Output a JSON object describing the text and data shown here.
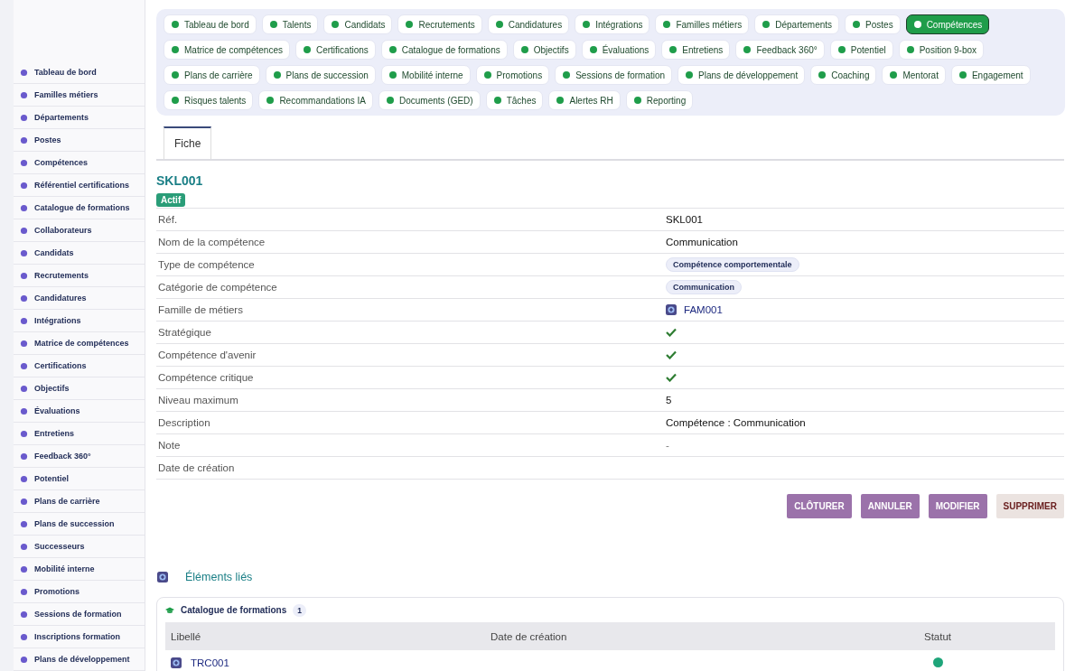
{
  "sidebar": {
    "items": [
      {
        "label": "Tableau de bord"
      },
      {
        "label": "Familles métiers"
      },
      {
        "label": "Départements"
      },
      {
        "label": "Postes"
      },
      {
        "label": "Compétences"
      },
      {
        "label": "Référentiel certifications"
      },
      {
        "label": "Catalogue de formations"
      },
      {
        "label": "Collaborateurs"
      },
      {
        "label": "Candidats"
      },
      {
        "label": "Recrutements"
      },
      {
        "label": "Candidatures"
      },
      {
        "label": "Intégrations"
      },
      {
        "label": "Matrice de compétences"
      },
      {
        "label": "Certifications"
      },
      {
        "label": "Objectifs"
      },
      {
        "label": "Évaluations"
      },
      {
        "label": "Entretiens"
      },
      {
        "label": "Feedback 360°"
      },
      {
        "label": "Potentiel"
      },
      {
        "label": "Plans de carrière"
      },
      {
        "label": "Plans de succession"
      },
      {
        "label": "Successeurs"
      },
      {
        "label": "Mobilité interne"
      },
      {
        "label": "Promotions"
      },
      {
        "label": "Sessions de formation"
      },
      {
        "label": "Inscriptions formation"
      },
      {
        "label": "Plans de développement"
      }
    ]
  },
  "modules": [
    {
      "label": "Tableau de bord",
      "selected": false
    },
    {
      "label": "Talents",
      "selected": false
    },
    {
      "label": "Candidats",
      "selected": false
    },
    {
      "label": "Recrutements",
      "selected": false
    },
    {
      "label": "Candidatures",
      "selected": false
    },
    {
      "label": "Intégrations",
      "selected": false
    },
    {
      "label": "Familles métiers",
      "selected": false
    },
    {
      "label": "Départements",
      "selected": false
    },
    {
      "label": "Postes",
      "selected": false
    },
    {
      "label": "Compétences",
      "selected": true
    },
    {
      "label": "Matrice de compétences",
      "selected": false
    },
    {
      "label": "Certifications",
      "selected": false
    },
    {
      "label": "Catalogue de formations",
      "selected": false
    },
    {
      "label": "Objectifs",
      "selected": false
    },
    {
      "label": "Évaluations",
      "selected": false
    },
    {
      "label": "Entretiens",
      "selected": false
    },
    {
      "label": "Feedback 360°",
      "selected": false
    },
    {
      "label": "Potentiel",
      "selected": false
    },
    {
      "label": "Position 9-box",
      "selected": false
    },
    {
      "label": "Plans de carrière",
      "selected": false
    },
    {
      "label": "Plans de succession",
      "selected": false
    },
    {
      "label": "Mobilité interne",
      "selected": false
    },
    {
      "label": "Promotions",
      "selected": false
    },
    {
      "label": "Sessions de formation",
      "selected": false
    },
    {
      "label": "Plans de développement",
      "selected": false
    },
    {
      "label": "Coaching",
      "selected": false
    },
    {
      "label": "Mentorat",
      "selected": false
    },
    {
      "label": "Engagement",
      "selected": false
    },
    {
      "label": "Risques talents",
      "selected": false
    },
    {
      "label": "Recommandations IA",
      "selected": false
    },
    {
      "label": "Documents (GED)",
      "selected": false
    },
    {
      "label": "Tâches",
      "selected": false
    },
    {
      "label": "Alertes RH",
      "selected": false
    },
    {
      "label": "Reporting",
      "selected": false
    }
  ],
  "tabs": [
    {
      "label": "Fiche",
      "selected": true
    }
  ],
  "record": {
    "title": "SKL001",
    "status": "Actif",
    "fields": [
      {
        "label": "Réf.",
        "kind": "text",
        "value": "SKL001"
      },
      {
        "label": "Nom de la compétence",
        "kind": "text",
        "value": "Communication"
      },
      {
        "label": "Type de compétence",
        "kind": "chip",
        "value": "Compétence comportementale"
      },
      {
        "label": "Catégorie de compétence",
        "kind": "chip",
        "value": "Communication"
      },
      {
        "label": "Famille de métiers",
        "kind": "link",
        "value": "FAM001"
      },
      {
        "label": "Stratégique",
        "kind": "check",
        "checked": true
      },
      {
        "label": "Compétence d'avenir",
        "kind": "check",
        "checked": true
      },
      {
        "label": "Compétence critique",
        "kind": "check",
        "checked": true
      },
      {
        "label": "Niveau maximum",
        "kind": "text",
        "value": "5"
      },
      {
        "label": "Description",
        "kind": "text",
        "value": "Compétence : Communication"
      },
      {
        "label": "Note",
        "kind": "muted",
        "value": "-"
      },
      {
        "label": "Date de création",
        "kind": "text"
      }
    ]
  },
  "actions": [
    {
      "label": "CLÔTURER",
      "kind": "primary"
    },
    {
      "label": "ANNULER",
      "kind": "primary"
    },
    {
      "label": "MODIFIER",
      "kind": "primary"
    },
    {
      "label": "SUPPRIMER",
      "kind": "danger"
    }
  ],
  "related": {
    "title": "Éléments liés",
    "panel": {
      "title": "Catalogue de formations",
      "count": "1",
      "columns": [
        "Libellé",
        "Date de création",
        "Statut"
      ],
      "rows": [
        {
          "label": "TRC001",
          "color": "#1fa57a"
        }
      ]
    }
  }
}
